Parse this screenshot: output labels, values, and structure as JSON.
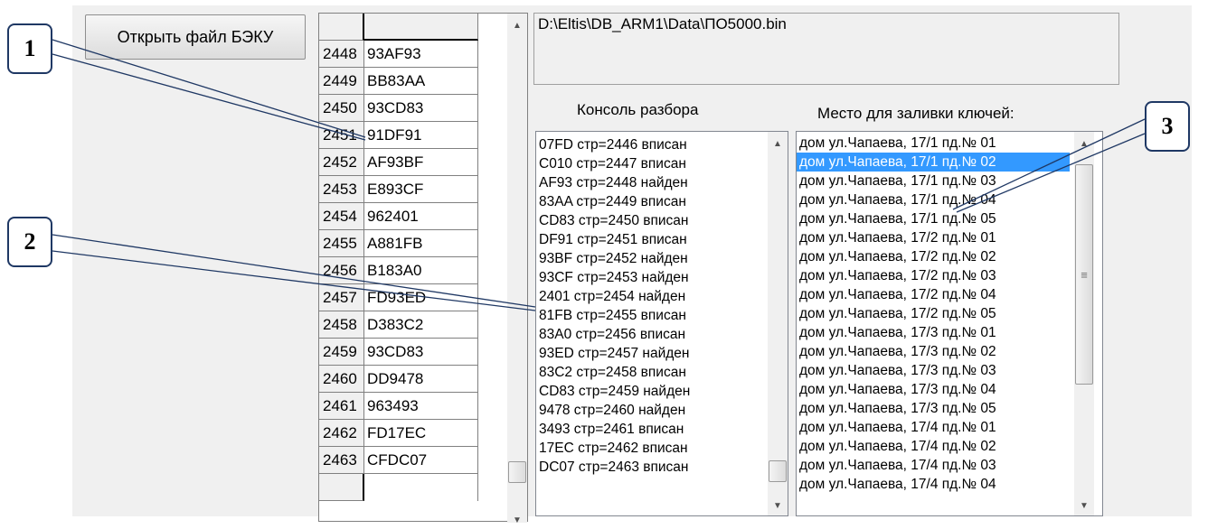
{
  "open_button_label": "Открыть файл БЭКУ",
  "file_path": "D:\\Eltis\\DB_ARM1\\Data\\ПО5000.bin",
  "console_label": "Консоль разбора",
  "keys_label": "Место для заливки ключей:",
  "grid_rows": [
    {
      "num": "2448",
      "val": "93AF93"
    },
    {
      "num": "2449",
      "val": "BB83AA"
    },
    {
      "num": "2450",
      "val": "93CD83"
    },
    {
      "num": "2451",
      "val": "91DF91"
    },
    {
      "num": "2452",
      "val": "AF93BF"
    },
    {
      "num": "2453",
      "val": "E893CF"
    },
    {
      "num": "2454",
      "val": "962401"
    },
    {
      "num": "2455",
      "val": "A881FB"
    },
    {
      "num": "2456",
      "val": "B183A0"
    },
    {
      "num": "2457",
      "val": "FD93ED"
    },
    {
      "num": "2458",
      "val": "D383C2"
    },
    {
      "num": "2459",
      "val": "93CD83"
    },
    {
      "num": "2460",
      "val": "DD9478"
    },
    {
      "num": "2461",
      "val": "963493"
    },
    {
      "num": "2462",
      "val": "FD17EC"
    },
    {
      "num": "2463",
      "val": "CFDC07"
    }
  ],
  "console_lines": [
    "07FD  стр=2446 вписан",
    "C010  стр=2447 вписан",
    "AF93  стр=2448 найден",
    "83AA  стр=2449 вписан",
    "CD83  стр=2450 вписан",
    "DF91  стр=2451 вписан",
    "93BF  стр=2452 найден",
    "93CF  стр=2453 найден",
    "2401  стр=2454 найден",
    "81FB  стр=2455 вписан",
    "83A0  стр=2456 вписан",
    "93ED  стр=2457 найден",
    "83C2  стр=2458 вписан",
    "CD83  стр=2459 найден",
    "9478  стр=2460 найден",
    "3493  стр=2461 вписан",
    "17EC  стр=2462 вписан",
    "DC07  стр=2463 вписан"
  ],
  "key_lines": [
    "дом ул.Чапаева, 17/1 пд.№ 01",
    "дом ул.Чапаева, 17/1 пд.№ 02",
    "дом ул.Чапаева, 17/1 пд.№ 03",
    "дом ул.Чапаева, 17/1 пд.№ 04",
    "дом ул.Чапаева, 17/1 пд.№ 05",
    "дом ул.Чапаева, 17/2 пд.№ 01",
    "дом ул.Чапаева, 17/2 пд.№ 02",
    "дом ул.Чапаева, 17/2 пд.№ 03",
    "дом ул.Чапаева, 17/2 пд.№ 04",
    "дом ул.Чапаева, 17/2 пд.№ 05",
    "дом ул.Чапаева, 17/3 пд.№ 01",
    "дом ул.Чапаева, 17/3 пд.№ 02",
    "дом ул.Чапаева, 17/3 пд.№ 03",
    "дом ул.Чапаева, 17/3 пд.№ 04",
    "дом ул.Чапаева, 17/3 пд.№ 05",
    "дом ул.Чапаева, 17/4 пд.№ 01",
    "дом ул.Чапаева, 17/4 пд.№ 02",
    "дом ул.Чапаева, 17/4 пд.№ 03",
    "дом ул.Чапаева, 17/4 пд.№ 04"
  ],
  "selected_key_index": 1,
  "callouts": [
    "1",
    "2",
    "3"
  ],
  "icons": {
    "scroll_up": "▲",
    "scroll_down": "▼",
    "grip": "≡"
  },
  "colors": {
    "selection": "#3399ff",
    "callout_border": "#1f3864",
    "leader_line": "#1f3864"
  }
}
